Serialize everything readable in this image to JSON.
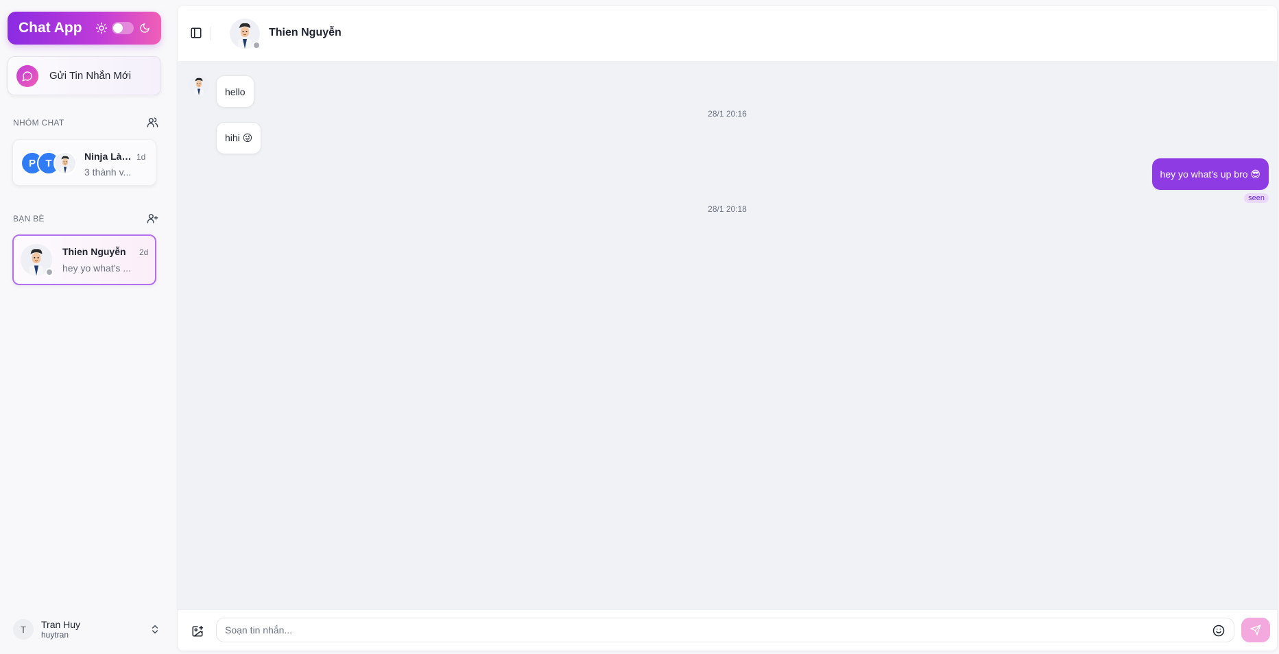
{
  "app": {
    "title": "Chat App"
  },
  "sidebar": {
    "new_message_label": "Gửi Tin Nhắn Mới",
    "groups_heading": "NHÓM CHAT",
    "friends_heading": "BẠN BÈ",
    "groups": [
      {
        "avatars": [
          "P",
          "T"
        ],
        "name": "Ninja Làn...",
        "time": "1d",
        "subtitle": "3 thành v..."
      }
    ],
    "friends": [
      {
        "name": "Thien Nguyễn",
        "time": "2d",
        "last_message": "hey yo what's ..."
      }
    ],
    "user": {
      "initial": "T",
      "name": "Tran Huy",
      "handle": "huytran"
    }
  },
  "chat": {
    "contact_name": "Thien Nguyễn",
    "messages": [
      {
        "direction": "in",
        "text": "hello"
      },
      {
        "direction": "in",
        "text": "hihi 😜"
      },
      {
        "direction": "out",
        "text": "hey yo what's up bro 😎",
        "status": "seen"
      }
    ],
    "timestamps": [
      "28/1 20:16",
      "28/1 20:18"
    ],
    "composer_placeholder": "Soạn tin nhắn..."
  },
  "colors": {
    "accent": "#8e3be3",
    "brand_gradient_start": "#8a2be2",
    "brand_gradient_end": "#f05fb6",
    "send_button": "#f3a9de"
  }
}
